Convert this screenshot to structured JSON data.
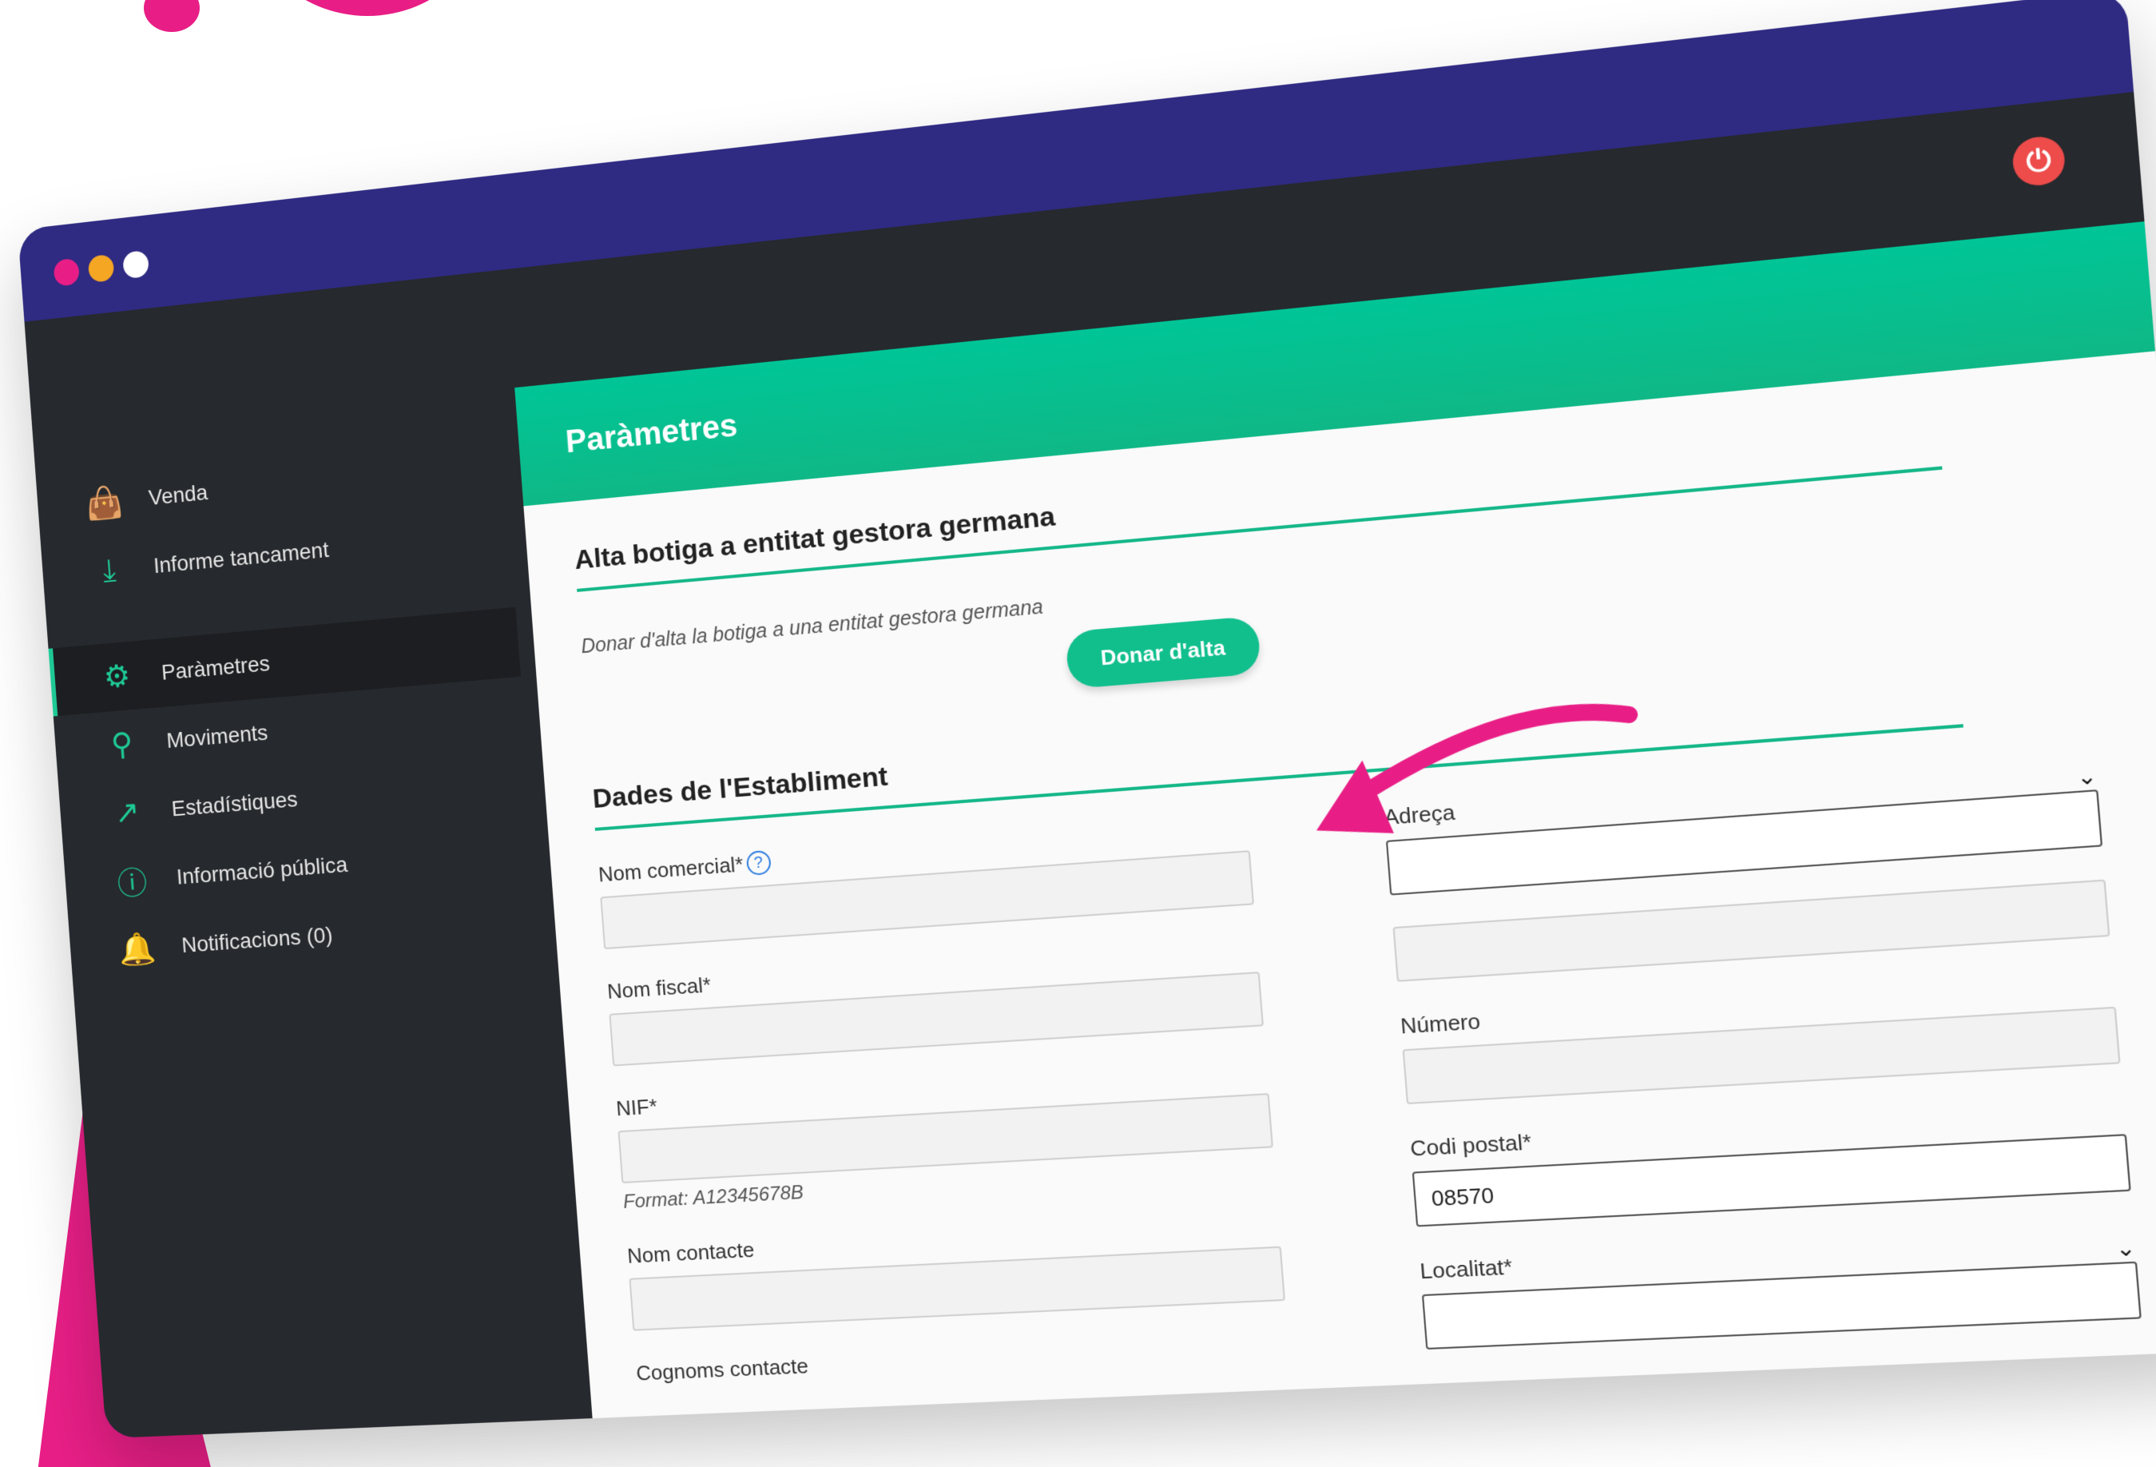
{
  "colors": {
    "accent": "#1ec995",
    "titlebar": "#2f2a82",
    "sidebar": "#26292d",
    "highlight": "#e81e86",
    "logout": "#ee4b4b"
  },
  "window": {
    "logout_icon": "logout-icon"
  },
  "sidebar": {
    "items": [
      {
        "label": "Venda",
        "icon": "shopping-bag-icon"
      },
      {
        "label": "Informe tancament",
        "icon": "download-tray-icon"
      },
      {
        "label": "Paràmetres",
        "icon": "sliders-icon"
      },
      {
        "label": "Moviments",
        "icon": "search-icon"
      },
      {
        "label": "Estadístiques",
        "icon": "chart-icon"
      },
      {
        "label": "Informació pública",
        "icon": "info-icon"
      },
      {
        "label": "Notificacions (0)",
        "icon": "bell-icon"
      }
    ]
  },
  "panel": {
    "title": "Paràmetres",
    "alta": {
      "title": "Alta botiga a entitat gestora germana",
      "description": "Donar d'alta la botiga a una entitat gestora germana",
      "button": "Donar d'alta"
    },
    "dades": {
      "title": "Dades de l'Establiment",
      "left": {
        "nom_comercial": {
          "label": "Nom comercial*",
          "value": ""
        },
        "nom_fiscal": {
          "label": "Nom fiscal*",
          "value": ""
        },
        "nif": {
          "label": "NIF*",
          "value": "",
          "hint": "Format: A12345678B"
        },
        "nom_contacte": {
          "label": "Nom contacte",
          "value": ""
        },
        "cognoms_contacte": {
          "label": "Cognoms contacte"
        }
      },
      "right": {
        "adreca": {
          "label": "Adreça",
          "value": ""
        },
        "adreca2": {
          "value": ""
        },
        "numero": {
          "label": "Número",
          "value": ""
        },
        "codi_postal": {
          "label": "Codi postal*",
          "value": "08570"
        },
        "localitat": {
          "label": "Localitat*",
          "value": ""
        }
      }
    }
  }
}
